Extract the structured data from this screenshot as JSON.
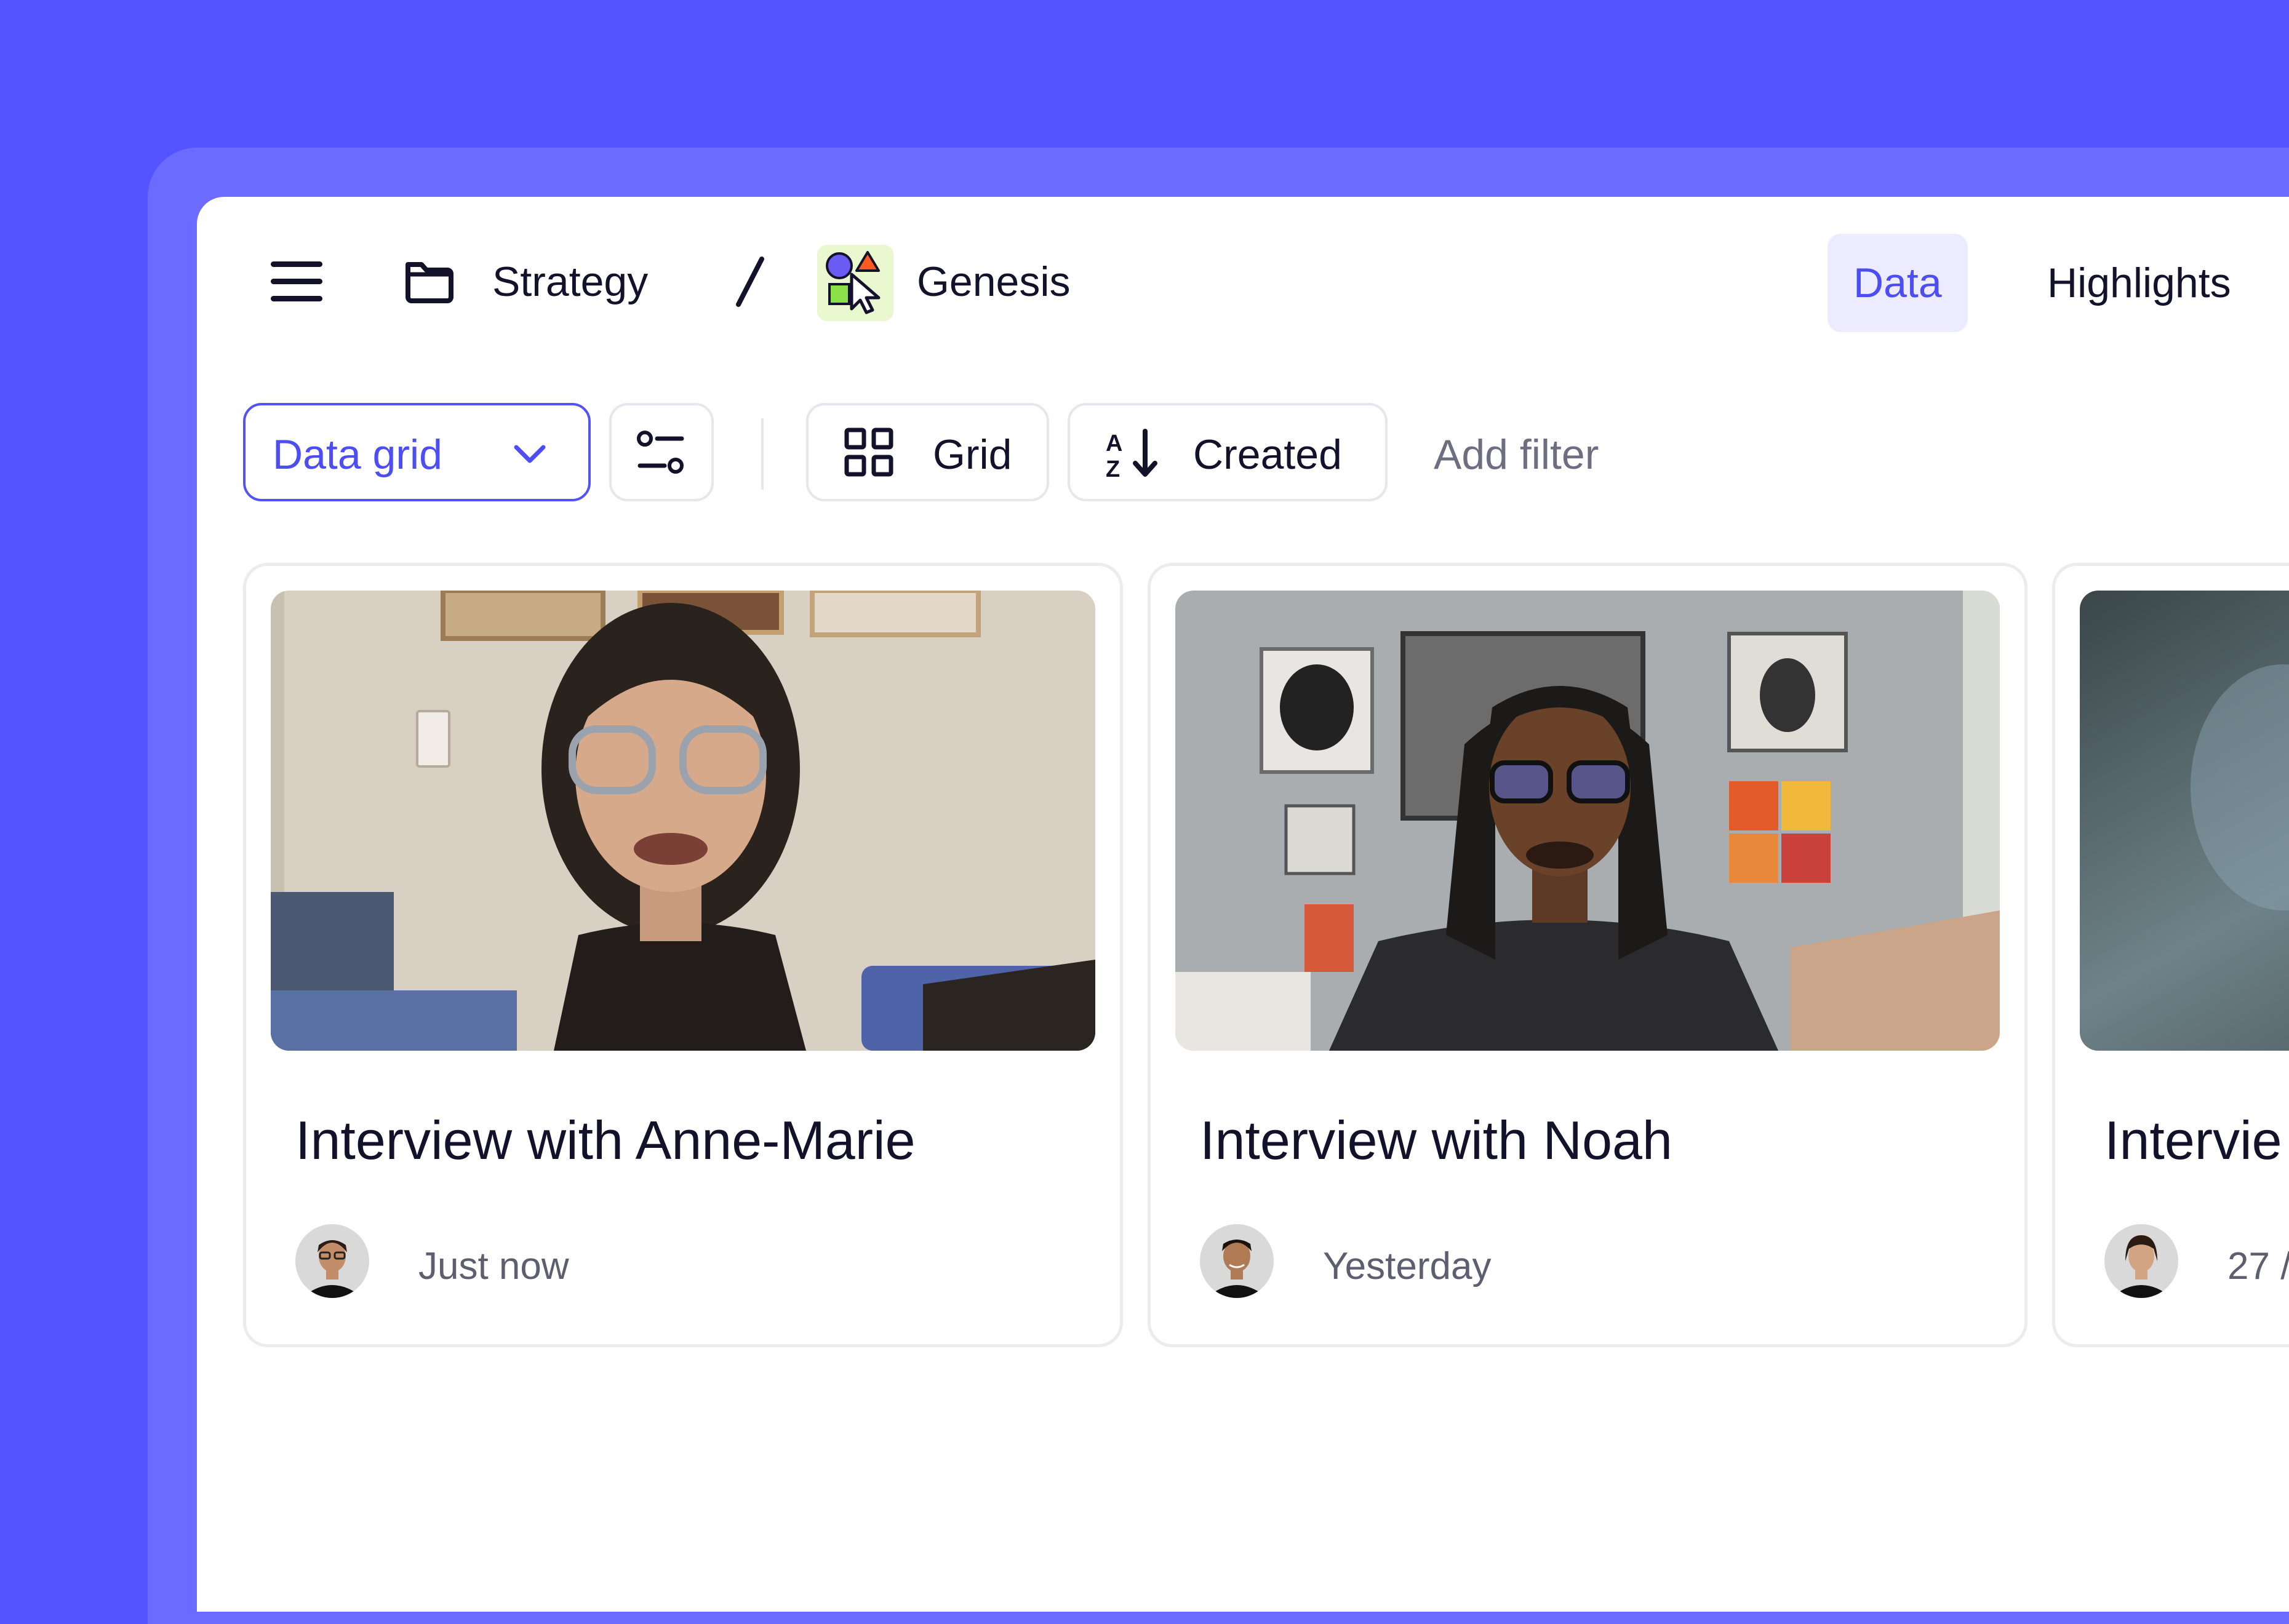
{
  "header": {
    "breadcrumb": {
      "folder": "Strategy",
      "separator": "/",
      "project": "Genesis"
    },
    "tabs": [
      {
        "label": "Data",
        "active": true
      },
      {
        "label": "Highlights",
        "active": false
      }
    ]
  },
  "toolbar": {
    "view_select": {
      "value": "Data grid"
    },
    "layout_button": {
      "label": "Grid"
    },
    "sort_button": {
      "label": "Created"
    },
    "add_filter": {
      "label": "Add filter"
    }
  },
  "cards": [
    {
      "title": "Interview with Anne-Marie",
      "time": "Just now"
    },
    {
      "title": "Interview with Noah",
      "time": "Yesterday"
    },
    {
      "title": "Intervie",
      "time": "27 /"
    }
  ],
  "colors": {
    "background": "#5454FF",
    "accent": "#4D4DF6",
    "active_tab_bg": "#ECEBFF"
  }
}
